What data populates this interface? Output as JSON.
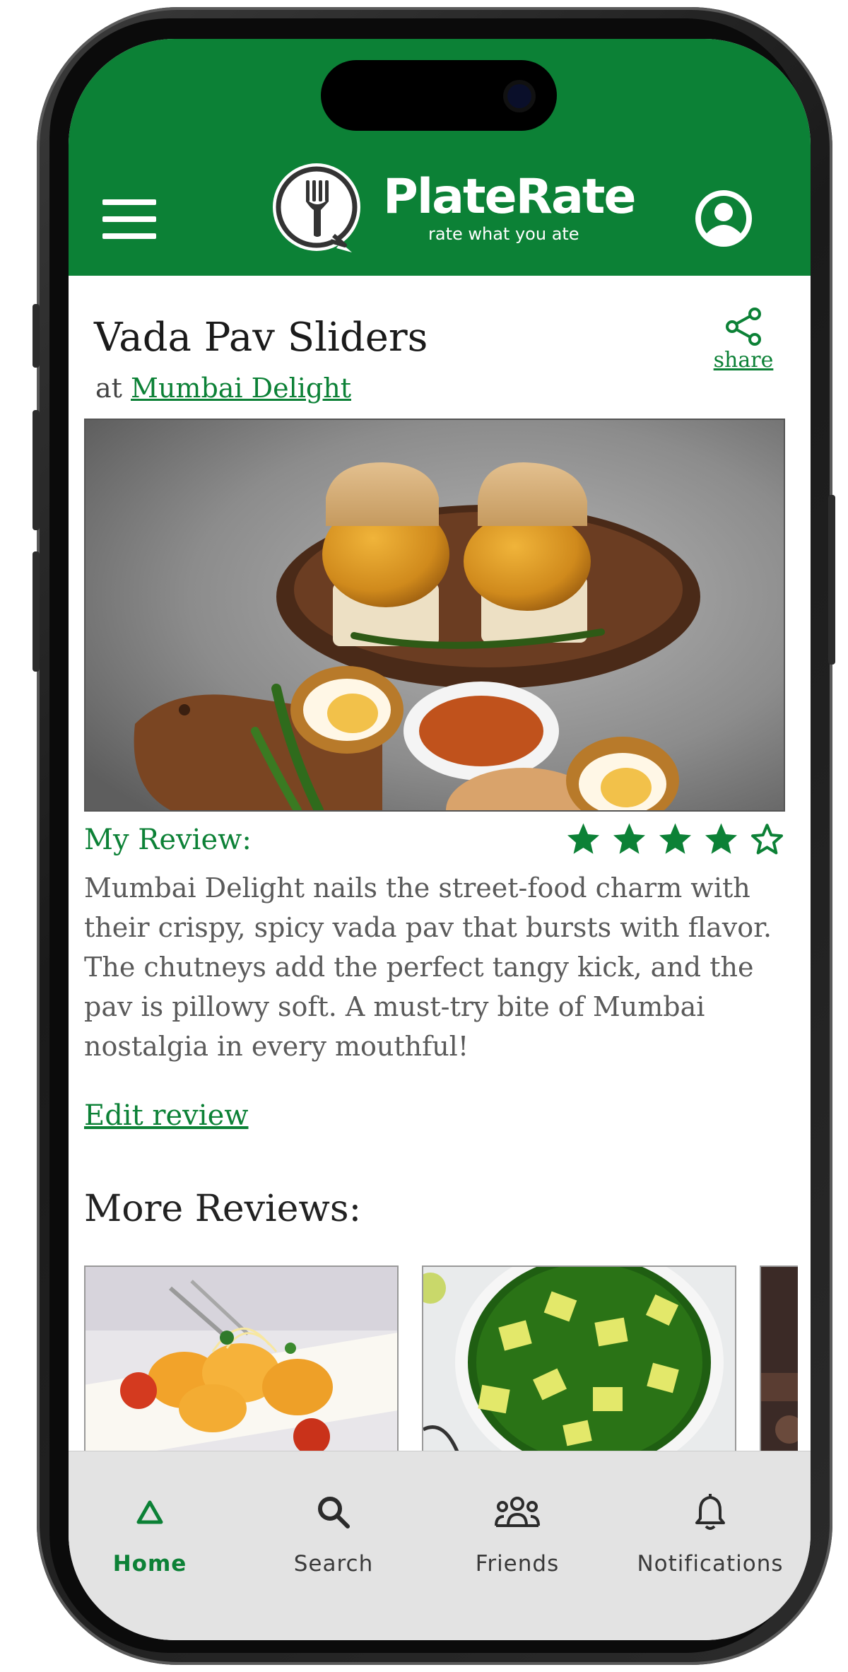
{
  "header": {
    "brand_name": "PlateRate",
    "brand_tagline": "rate what you ate",
    "accent_color": "#0c8136",
    "menu_icon": "hamburger-menu-icon",
    "profile_icon": "user-profile-icon"
  },
  "dish": {
    "title": "Vada Pav Sliders",
    "at_prefix": "at",
    "restaurant": "Mumbai Delight",
    "share_label": "share"
  },
  "review": {
    "label": "My Review:",
    "rating": 4,
    "rating_max": 5,
    "text": "Mumbai Delight nails the street-food charm with their crispy, spicy vada pav that bursts with flavor. The chutneys add the perfect tangy kick, and the pav is pillowy soft. A must-try bite of Mumbai nostalgia in every mouthful!",
    "edit_label": "Edit review"
  },
  "more_reviews": {
    "title": "More Reviews:",
    "items": [
      {
        "image": "pasta-tortellini-dish"
      },
      {
        "image": "palak-paneer-bowl"
      },
      {
        "image": "partial-dark-dish"
      }
    ]
  },
  "bottom_nav": {
    "items": [
      {
        "label": "Home",
        "icon": "home-triangle-icon",
        "active": true
      },
      {
        "label": "Search",
        "icon": "search-icon",
        "active": false
      },
      {
        "label": "Friends",
        "icon": "friends-icon",
        "active": false
      },
      {
        "label": "Notifications",
        "icon": "bell-icon",
        "active": false
      }
    ]
  }
}
